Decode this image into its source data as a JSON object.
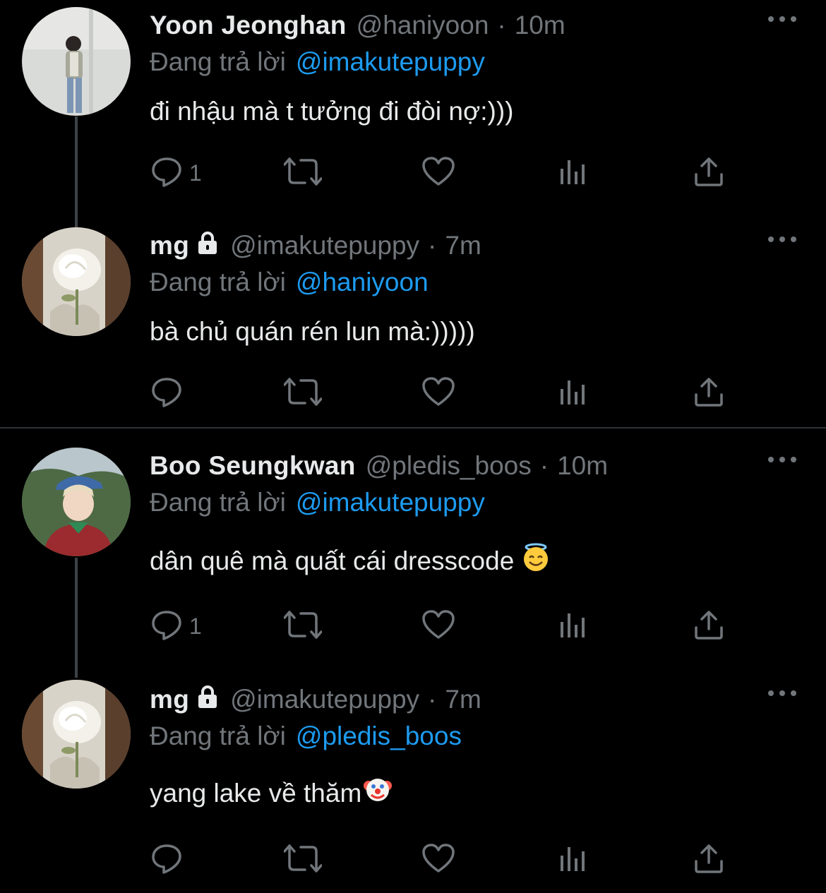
{
  "tweets": [
    {
      "display_name": "Yoon Jeonghan",
      "locked": false,
      "handle": "@haniyoon",
      "time": "10m",
      "reply_prefix": "Đang trả lời",
      "reply_to": "@imakutepuppy",
      "text": "đi nhậu mà t tưởng đi đòi nợ:)))",
      "emoji": "",
      "reply_count": "1",
      "avatar": "person-standing-light-background"
    },
    {
      "display_name": "mg",
      "locked": true,
      "handle": "@imakutepuppy",
      "time": "7m",
      "reply_prefix": "Đang trả lời",
      "reply_to": "@haniyoon",
      "text": "bà chủ quán rén lun mà:)))))",
      "emoji": "",
      "reply_count": "",
      "avatar": "white-rose"
    },
    {
      "display_name": "Boo Seungkwan",
      "locked": false,
      "handle": "@pledis_boos",
      "time": "10m",
      "reply_prefix": "Đang trả lời",
      "reply_to": "@imakutepuppy",
      "text": "dân quê mà quất cái dresscode ",
      "emoji": "halo-smile-emoji",
      "reply_count": "1",
      "avatar": "person-in-visor"
    },
    {
      "display_name": "mg",
      "locked": true,
      "handle": "@imakutepuppy",
      "time": "7m",
      "reply_prefix": "Đang trả lời",
      "reply_to": "@pledis_boos",
      "text": "yang lake về thăm",
      "emoji": "clown-face-emoji",
      "reply_count": "",
      "avatar": "white-rose"
    }
  ],
  "colors": {
    "background": "#000000",
    "primary_text": "#e7e9ea",
    "secondary_text": "#71767b",
    "accent": "#1d9bf0",
    "thread_line": "#3d4247"
  },
  "action_icons": [
    "reply-icon",
    "retweet-icon",
    "like-icon",
    "analytics-icon",
    "share-icon"
  ]
}
